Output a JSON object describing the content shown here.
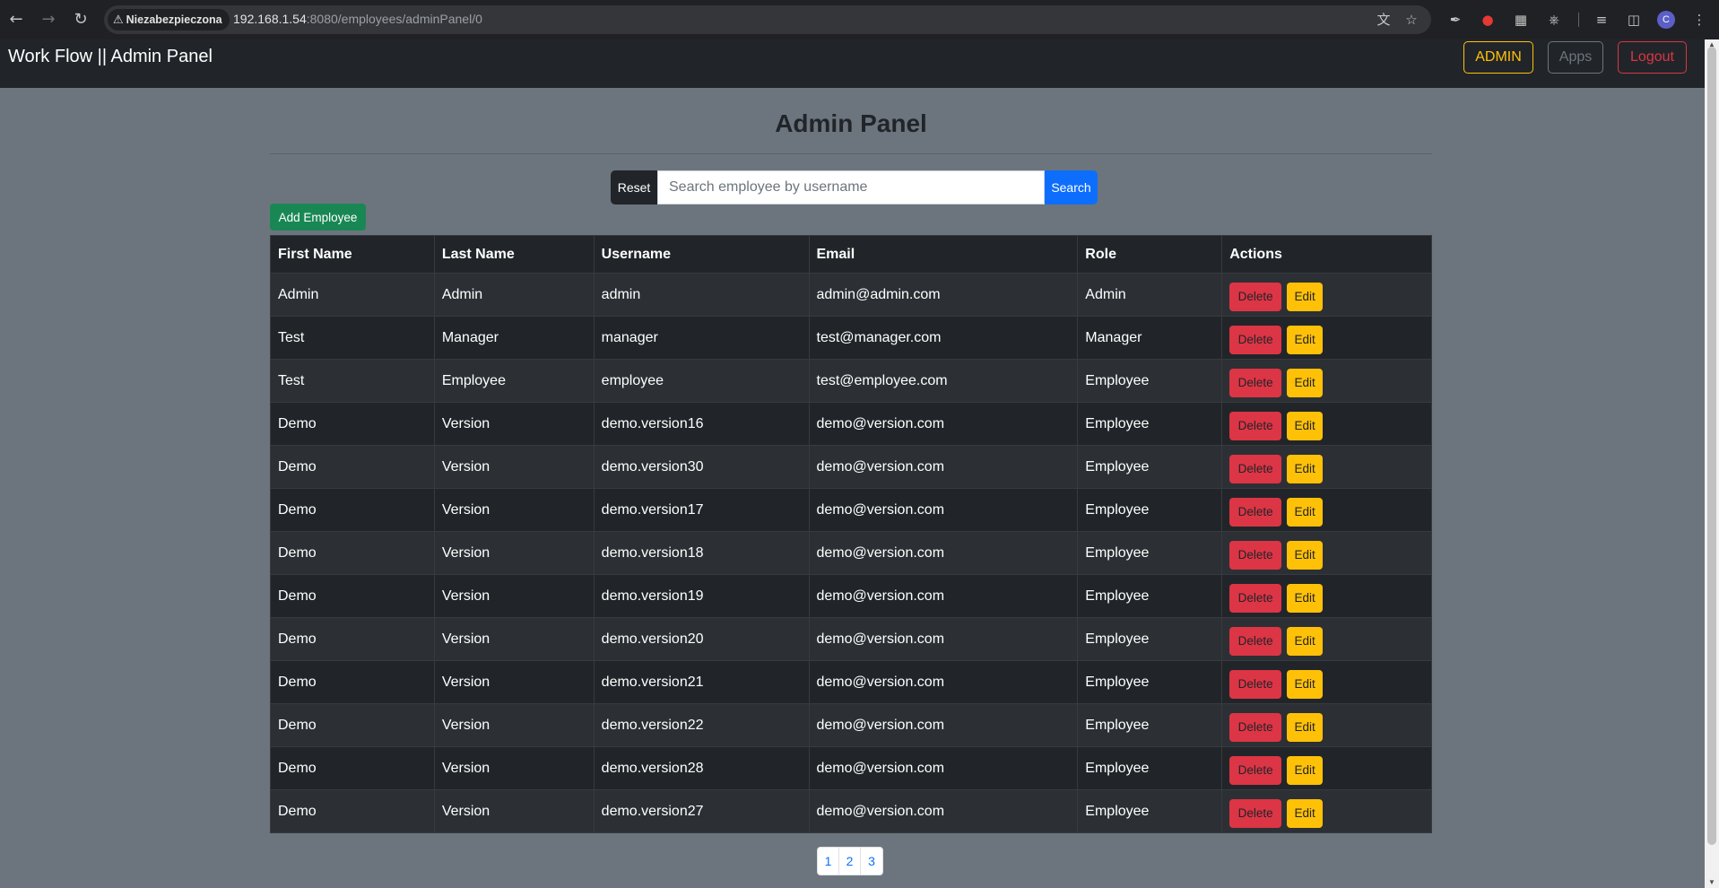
{
  "browser": {
    "security_label": "Niezabezpieczona",
    "url_host": "192.168.1.54",
    "url_rest": ":8080/employees/adminPanel/0",
    "profile_initial": "C"
  },
  "navbar": {
    "brand": "Work Flow || Admin Panel",
    "admin_label": "ADMIN",
    "apps_label": "Apps",
    "logout_label": "Logout"
  },
  "main": {
    "title": "Admin Panel",
    "reset_label": "Reset",
    "search_placeholder": "Search employee by username",
    "search_label": "Search",
    "add_label": "Add Employee"
  },
  "table": {
    "headers": [
      "First Name",
      "Last Name",
      "Username",
      "Email",
      "Role",
      "Actions"
    ],
    "delete_label": "Delete",
    "edit_label": "Edit",
    "rows": [
      [
        "Admin",
        "Admin",
        "admin",
        "admin@admin.com",
        "Admin"
      ],
      [
        "Test",
        "Manager",
        "manager",
        "test@manager.com",
        "Manager"
      ],
      [
        "Test",
        "Employee",
        "employee",
        "test@employee.com",
        "Employee"
      ],
      [
        "Demo",
        "Version",
        "demo.version16",
        "demo@version.com",
        "Employee"
      ],
      [
        "Demo",
        "Version",
        "demo.version30",
        "demo@version.com",
        "Employee"
      ],
      [
        "Demo",
        "Version",
        "demo.version17",
        "demo@version.com",
        "Employee"
      ],
      [
        "Demo",
        "Version",
        "demo.version18",
        "demo@version.com",
        "Employee"
      ],
      [
        "Demo",
        "Version",
        "demo.version19",
        "demo@version.com",
        "Employee"
      ],
      [
        "Demo",
        "Version",
        "demo.version20",
        "demo@version.com",
        "Employee"
      ],
      [
        "Demo",
        "Version",
        "demo.version21",
        "demo@version.com",
        "Employee"
      ],
      [
        "Demo",
        "Version",
        "demo.version22",
        "demo@version.com",
        "Employee"
      ],
      [
        "Demo",
        "Version",
        "demo.version28",
        "demo@version.com",
        "Employee"
      ],
      [
        "Demo",
        "Version",
        "demo.version27",
        "demo@version.com",
        "Employee"
      ]
    ]
  },
  "pagination": {
    "pages": [
      "1",
      "2",
      "3"
    ]
  },
  "colors": {
    "page_bg": "#6c757d",
    "navbar_bg": "#212529",
    "admin": "#ffc107",
    "logout": "#dc3545",
    "search": "#0d6efd",
    "add": "#198754"
  }
}
